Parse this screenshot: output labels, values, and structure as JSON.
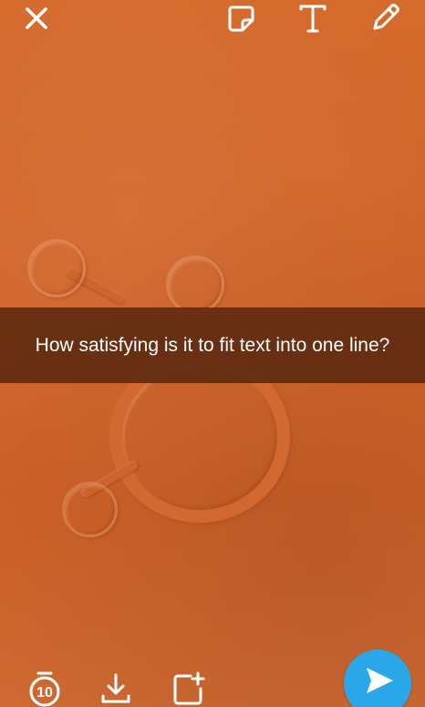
{
  "caption": {
    "text": "How satisfying is it to fit text into one line?"
  },
  "toolbar_top": {
    "close_icon": "close-icon",
    "sticker_icon": "sticker-icon",
    "text_icon": "text-icon",
    "pencil_icon": "pencil-icon"
  },
  "toolbar_bottom": {
    "timer_value": "10",
    "timer_icon": "timer-icon",
    "download_icon": "download-icon",
    "add_story_icon": "add-story-icon",
    "send_icon": "send-arrow-icon"
  },
  "colors": {
    "background": "#d5692a",
    "caption_bar": "#5a280f",
    "send_button": "#2aa7e8",
    "icon": "#ffffff"
  }
}
